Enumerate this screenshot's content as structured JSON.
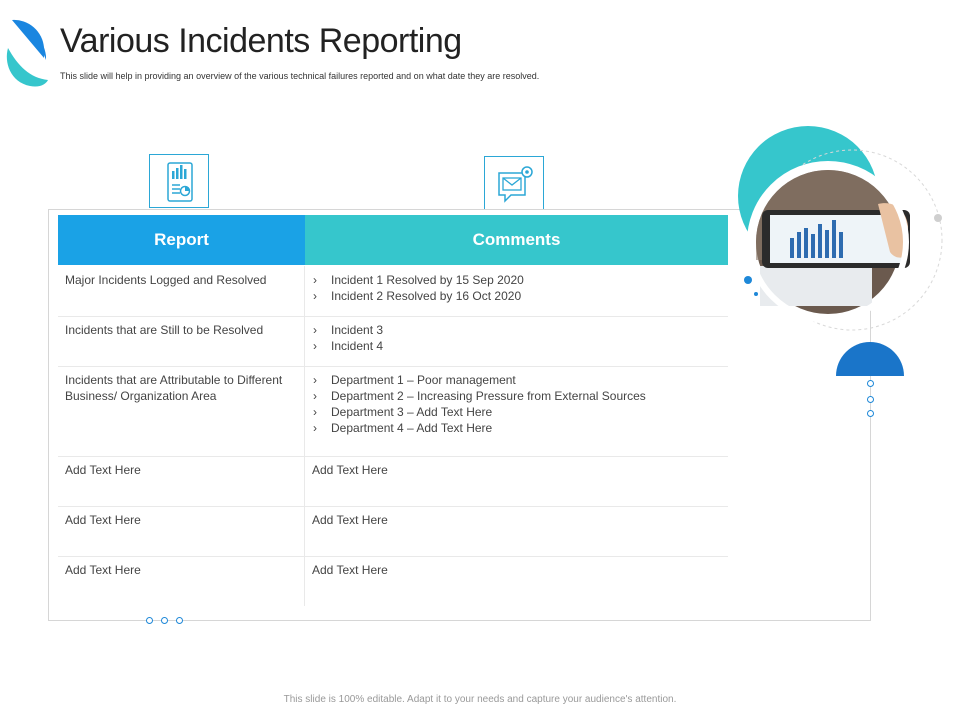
{
  "header": {
    "title": "Various Incidents Reporting",
    "subtitle": "This slide will help in providing an overview of the various technical failures reported and on what date they are resolved."
  },
  "icons": {
    "report": "report-chart-icon",
    "comments": "email-settings-icon"
  },
  "table": {
    "columns": [
      "Report",
      "Comments"
    ],
    "rows": [
      {
        "report": "Major Incidents Logged and Resolved",
        "comments": [
          "Incident 1 Resolved by 15 Sep 2020",
          "Incident 2 Resolved by 16 Oct 2020"
        ]
      },
      {
        "report": "Incidents that are Still to be Resolved",
        "comments": [
          "Incident 3",
          "Incident 4"
        ]
      },
      {
        "report": "Incidents that are Attributable to Different Business/ Organization Area",
        "comments": [
          "Department 1 – Poor management",
          "Department 2 – Increasing Pressure from External Sources",
          "Department 3 – Add Text Here",
          "Department 4 – Add Text Here"
        ]
      },
      {
        "report": "Add Text Here",
        "comments_text": "Add Text Here"
      },
      {
        "report": "Add Text Here",
        "comments_text": "Add Text Here"
      },
      {
        "report": "Add Text Here",
        "comments_text": "Add Text Here"
      }
    ]
  },
  "bullet_glyph": "›",
  "footer": "This slide is 100% editable. Adapt it to your needs and capture your audience's attention.",
  "colors": {
    "report_header": "#1aa2e6",
    "comments_header": "#36c6cc",
    "accent_blue": "#1e88d8",
    "accent_teal": "#36c6cc"
  }
}
